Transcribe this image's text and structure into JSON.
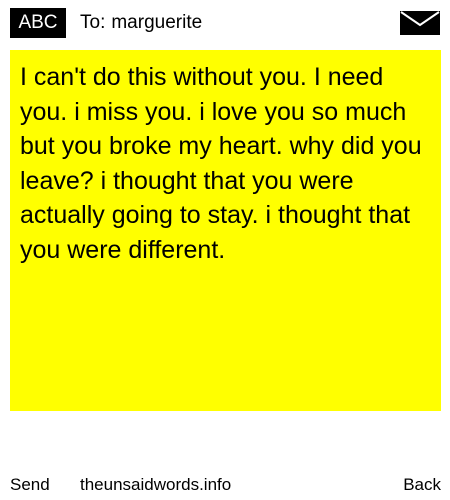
{
  "header": {
    "input_mode": "ABC",
    "to_prefix": "To:",
    "recipient": "marguerite",
    "envelope_icon": "envelope-icon"
  },
  "message": {
    "background": "#ffff00",
    "text": "I can't do this without you. I need you. i miss you. i love you so much but you broke my heart. why did you leave? i thought that you were actually going to stay. i thought that you were different."
  },
  "footer": {
    "send_label": "Send",
    "site": "theunsaidwords.info",
    "back_label": "Back"
  }
}
